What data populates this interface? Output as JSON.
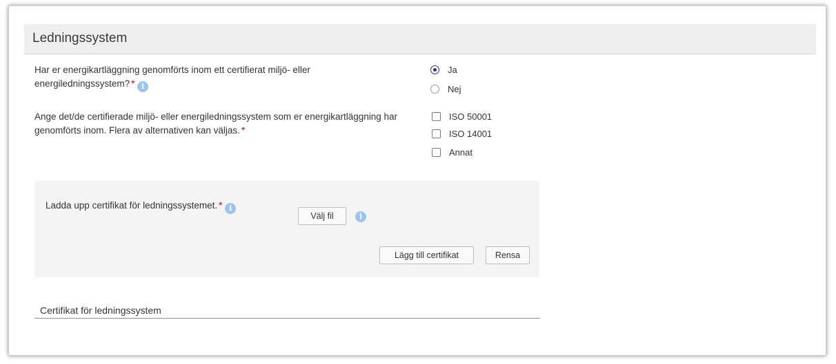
{
  "section": {
    "title": "Ledningssystem"
  },
  "question1": {
    "text": "Har er energikartläggning genomförts inom ett certifierat miljö- eller energiledningssystem?",
    "required_mark": "*",
    "info_glyph": "i",
    "options": [
      {
        "label": "Ja",
        "checked": true
      },
      {
        "label": "Nej",
        "checked": false
      }
    ]
  },
  "question2": {
    "text": "Ange det/de certifierade miljö- eller energiledningssystem som er energikartläggning har genomförts inom. Flera av alternativen kan väljas.",
    "required_mark": "*",
    "options": [
      {
        "label": "ISO 50001",
        "checked": false
      },
      {
        "label": "ISO 14001",
        "checked": false
      },
      {
        "label": "Annat",
        "checked": false
      }
    ]
  },
  "upload": {
    "label": "Ladda upp certifikat för ledningssystemet.",
    "required_mark": "*",
    "info_glyph": "i",
    "choose_file_label": "Välj fil",
    "add_certificate_label": "Lägg till certifikat",
    "clear_label": "Rensa"
  },
  "certificates": {
    "heading": "Certifikat för ledningssystem"
  },
  "icons": {
    "info": "info-icon"
  },
  "colors": {
    "required": "#cc0000",
    "info_icon": "#9ec3ef",
    "header_bg": "#efefef",
    "upload_bg": "#f4f4f4"
  }
}
